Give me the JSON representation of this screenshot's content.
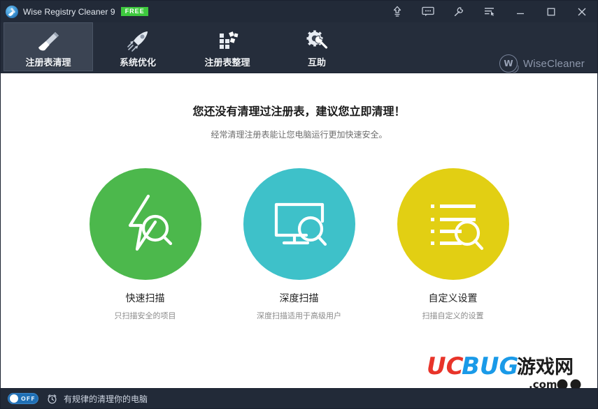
{
  "window": {
    "title": "Wise Registry Cleaner 9",
    "edition_badge": "FREE",
    "app_icon": "broom-app-icon"
  },
  "titlebar": {
    "buttons": [
      {
        "name": "upgrade-icon",
        "label": "Upgrade"
      },
      {
        "name": "feedback-icon",
        "label": "Feedback"
      },
      {
        "name": "tools-icon",
        "label": "Tools"
      },
      {
        "name": "menu-icon",
        "label": "Menu"
      },
      {
        "name": "minimize-icon",
        "label": "Minimize"
      },
      {
        "name": "maximize-icon",
        "label": "Maximize"
      },
      {
        "name": "close-icon",
        "label": "Close"
      }
    ]
  },
  "nav": {
    "tabs": [
      {
        "label": "注册表清理",
        "icon": "broom-icon",
        "active": true
      },
      {
        "label": "系统优化",
        "icon": "rocket-icon",
        "active": false
      },
      {
        "label": "注册表整理",
        "icon": "defrag-icon",
        "active": false
      },
      {
        "label": "互助",
        "icon": "wrench-gear-icon",
        "active": false
      }
    ],
    "brand": {
      "mark": "W",
      "name": "WiseCleaner"
    }
  },
  "main": {
    "headline": "您还没有清理过注册表，建议您立即清理！",
    "subhead": "经常清理注册表能让您电脑运行更加快速安全。",
    "actions": [
      {
        "title": "快速扫描",
        "desc": "只扫描安全的项目",
        "color": "#4cb84c",
        "icon": "lightning-search-icon"
      },
      {
        "title": "深度扫描",
        "desc": "深度扫描适用于高级用户",
        "color": "#3ec1c9",
        "icon": "monitor-search-icon"
      },
      {
        "title": "自定义设置",
        "desc": "扫描自定义的设置",
        "color": "#e2cf13",
        "icon": "list-search-icon"
      }
    ]
  },
  "statusbar": {
    "toggle_state": "OFF",
    "clock_icon": "alarm-clock-icon",
    "text": "有规律的清理你的电脑"
  },
  "watermark": {
    "part1": "UC",
    "part2": "BUG",
    "part3": "游戏网",
    "domain": ".com"
  },
  "colors": {
    "titlebar_bg": "#222a38",
    "nav_bg": "#252d3b",
    "active_tab_bg": "#3b4453",
    "content_bg": "#ffffff",
    "badge_green": "#3ec93e",
    "toggle_blue": "#1f6fb5"
  }
}
